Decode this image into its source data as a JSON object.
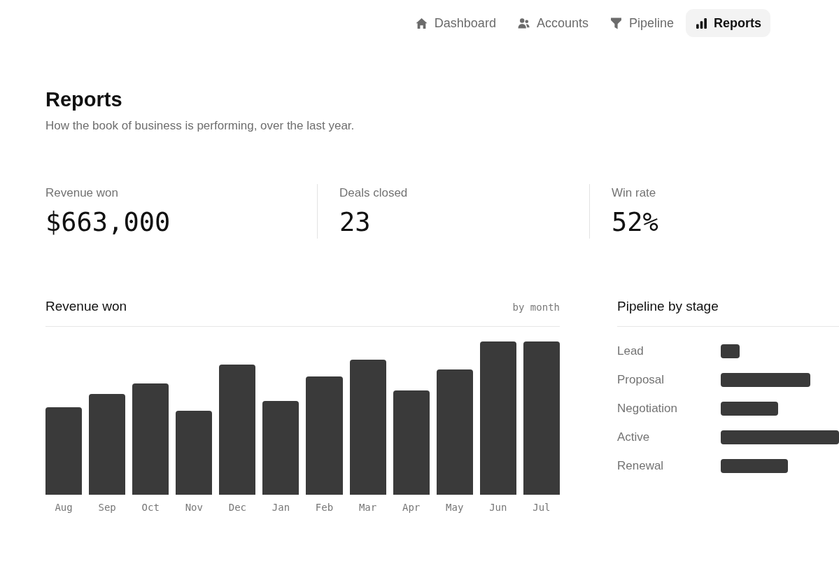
{
  "nav": {
    "tabs": [
      {
        "label": "Dashboard",
        "selected": false
      },
      {
        "label": "Accounts",
        "selected": false
      },
      {
        "label": "Pipeline",
        "selected": false
      },
      {
        "label": "Reports",
        "selected": true
      }
    ]
  },
  "header": {
    "title": "Reports",
    "subtitle": "How the book of business is performing, over the last year."
  },
  "stats": [
    {
      "label": "Revenue won",
      "value": "$663,000"
    },
    {
      "label": "Deals closed",
      "value": "23"
    },
    {
      "label": "Win rate",
      "value": "52%"
    }
  ],
  "revenue_chart": {
    "title": "Revenue won",
    "period": "by month",
    "months": [
      "Aug",
      "Sep",
      "Oct",
      "Nov",
      "Dec",
      "Jan",
      "Feb",
      "Mar",
      "Apr",
      "May",
      "Jun",
      "Jul"
    ]
  },
  "pipeline": {
    "title": "Pipeline by stage",
    "stages": [
      "Lead",
      "Proposal",
      "Negotiation",
      "Active",
      "Renewal"
    ]
  }
}
